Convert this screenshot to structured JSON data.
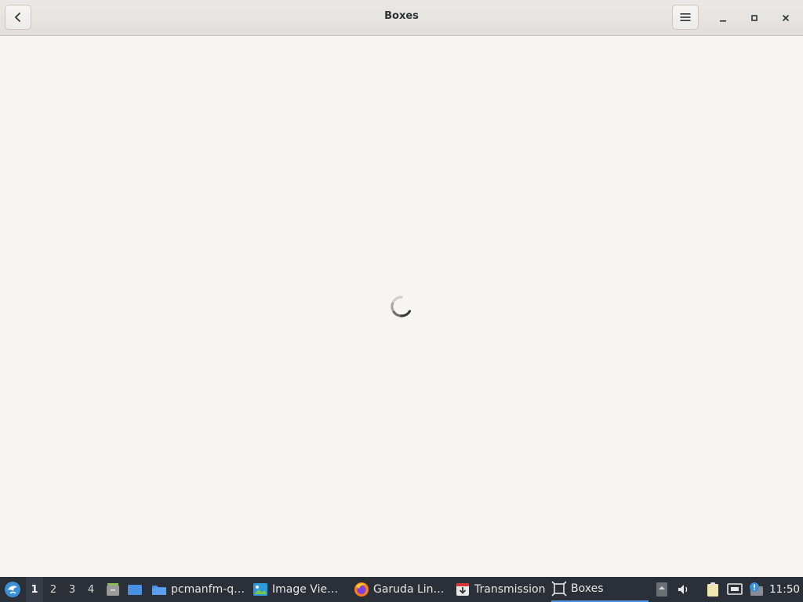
{
  "window": {
    "title": "Boxes"
  },
  "taskbar": {
    "workspaces": [
      "1",
      "2",
      "3",
      "4"
    ],
    "active_workspace": "1",
    "tasks": [
      {
        "label": "pcmanfm-q…",
        "icon": "folder-icon"
      },
      {
        "label": "Image Vie…",
        "icon": "image-viewer-icon"
      },
      {
        "label": "Garuda Lin…",
        "icon": "firefox-icon"
      },
      {
        "label": "Transmission",
        "icon": "transmission-icon"
      },
      {
        "label": "Boxes",
        "icon": "boxes-icon",
        "active": true
      }
    ],
    "clock": "11:50"
  },
  "colors": {
    "accent": "#5294e2",
    "taskbar_bg": "#2a2f38",
    "window_bg": "#f6f5f4"
  }
}
